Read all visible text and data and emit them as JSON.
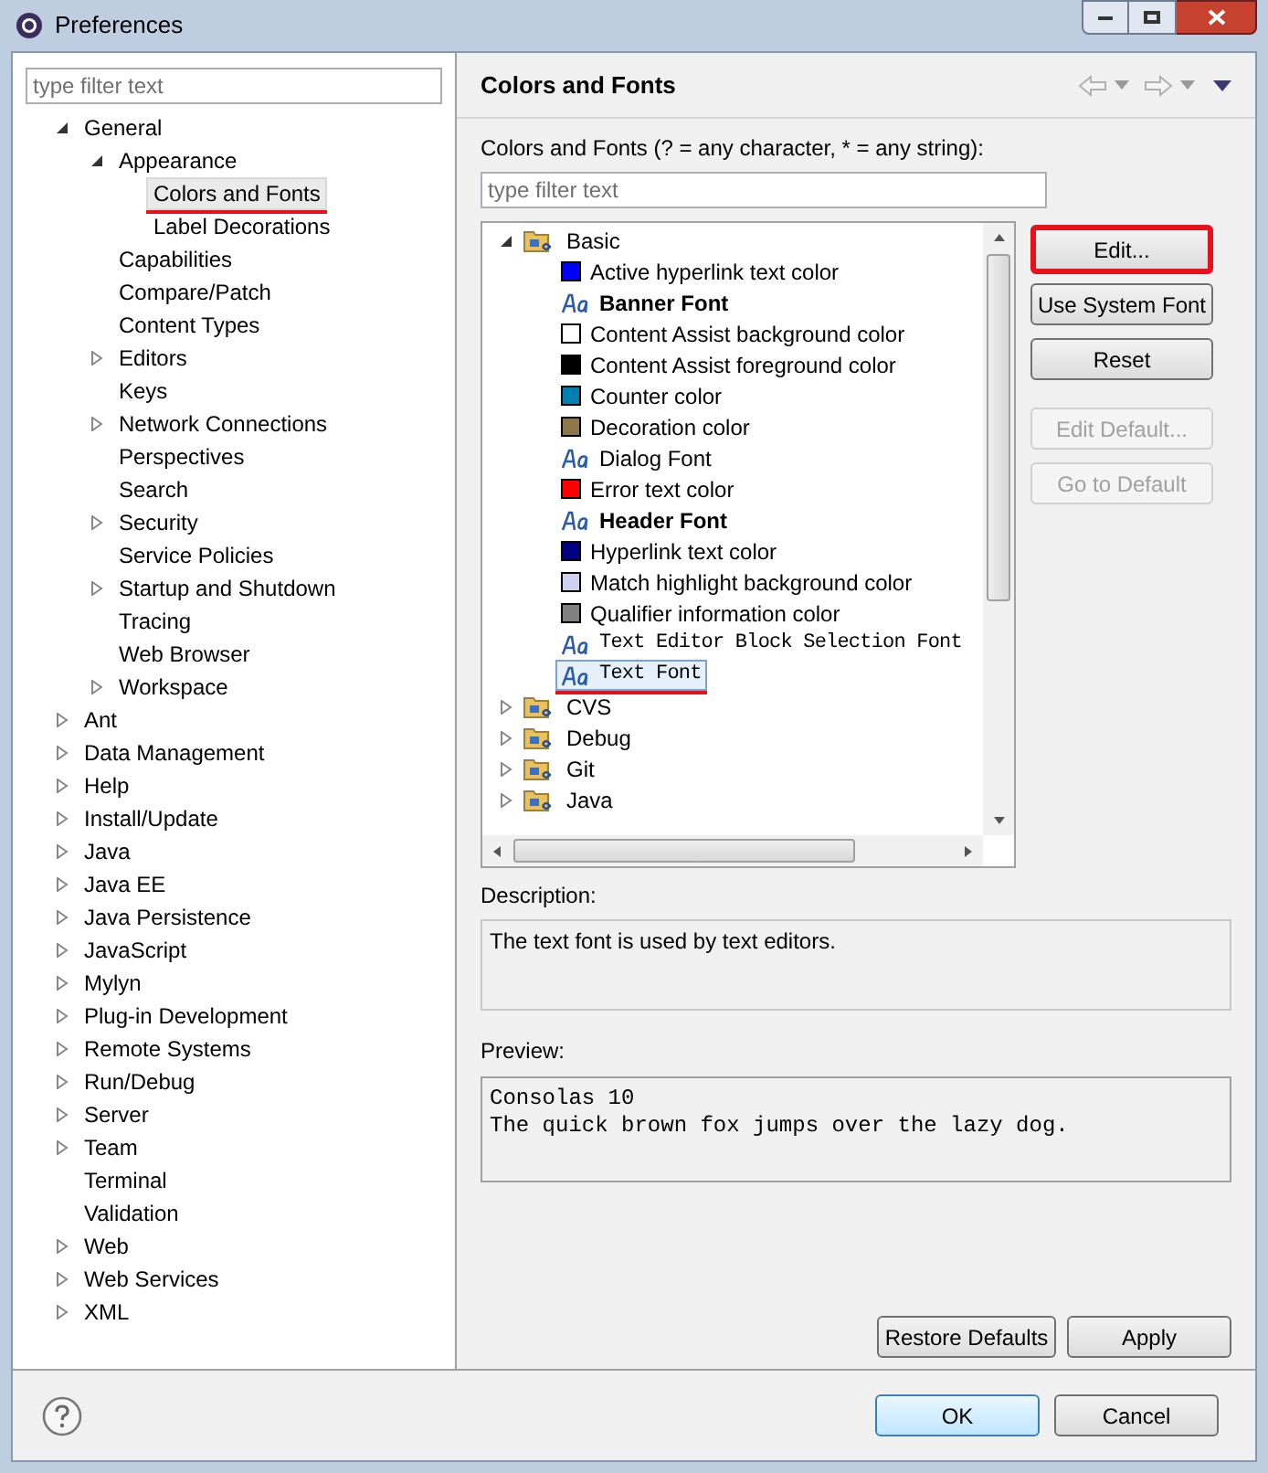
{
  "window": {
    "title": "Preferences"
  },
  "sidebar": {
    "filter": {
      "placeholder": "type filter text"
    },
    "items": [
      {
        "label": "General",
        "expanded": true,
        "selected": false,
        "children": [
          {
            "label": "Appearance",
            "expanded": true,
            "selected": false,
            "children": [
              {
                "label": "Colors and Fonts",
                "selected": true
              },
              {
                "label": "Label Decorations",
                "selected": false
              }
            ]
          },
          {
            "label": "Capabilities",
            "selected": false
          },
          {
            "label": "Compare/Patch",
            "selected": false
          },
          {
            "label": "Content Types",
            "selected": false
          },
          {
            "label": "Editors",
            "expanded": false,
            "selected": false
          },
          {
            "label": "Keys",
            "selected": false
          },
          {
            "label": "Network Connections",
            "expanded": false,
            "selected": false
          },
          {
            "label": "Perspectives",
            "selected": false
          },
          {
            "label": "Search",
            "selected": false
          },
          {
            "label": "Security",
            "expanded": false,
            "selected": false
          },
          {
            "label": "Service Policies",
            "selected": false
          },
          {
            "label": "Startup and Shutdown",
            "expanded": false,
            "selected": false
          },
          {
            "label": "Tracing",
            "selected": false
          },
          {
            "label": "Web Browser",
            "selected": false
          },
          {
            "label": "Workspace",
            "expanded": false,
            "selected": false
          }
        ]
      },
      {
        "label": "Ant",
        "expanded": false,
        "selected": false
      },
      {
        "label": "Data Management",
        "expanded": false,
        "selected": false
      },
      {
        "label": "Help",
        "expanded": false,
        "selected": false
      },
      {
        "label": "Install/Update",
        "expanded": false,
        "selected": false
      },
      {
        "label": "Java",
        "expanded": false,
        "selected": false
      },
      {
        "label": "Java EE",
        "expanded": false,
        "selected": false
      },
      {
        "label": "Java Persistence",
        "expanded": false,
        "selected": false
      },
      {
        "label": "JavaScript",
        "expanded": false,
        "selected": false
      },
      {
        "label": "Mylyn",
        "expanded": false,
        "selected": false
      },
      {
        "label": "Plug-in Development",
        "expanded": false,
        "selected": false
      },
      {
        "label": "Remote Systems",
        "expanded": false,
        "selected": false
      },
      {
        "label": "Run/Debug",
        "expanded": false,
        "selected": false
      },
      {
        "label": "Server",
        "expanded": false,
        "selected": false
      },
      {
        "label": "Team",
        "expanded": false,
        "selected": false
      },
      {
        "label": "Terminal",
        "selected": false
      },
      {
        "label": "Validation",
        "selected": false
      },
      {
        "label": "Web",
        "expanded": false,
        "selected": false
      },
      {
        "label": "Web Services",
        "expanded": false,
        "selected": false
      },
      {
        "label": "XML",
        "expanded": false,
        "selected": false
      }
    ]
  },
  "page": {
    "title": "Colors and Fonts",
    "filter_label": "Colors and Fonts (? = any character, * = any string):",
    "filter": {
      "placeholder": "type filter text"
    },
    "categories": [
      {
        "label": "Basic",
        "expanded": true,
        "children": [
          {
            "kind": "color",
            "label": "Active hyperlink text color",
            "color": "#0000ff",
            "selected": false
          },
          {
            "kind": "boldfont",
            "label": "Banner Font",
            "selected": false
          },
          {
            "kind": "color",
            "label": "Content Assist background color",
            "color": "#ffffff",
            "selected": false
          },
          {
            "kind": "color",
            "label": "Content Assist foreground color",
            "color": "#000000",
            "selected": false
          },
          {
            "kind": "color",
            "label": "Counter color",
            "color": "#0080b0",
            "selected": false
          },
          {
            "kind": "color",
            "label": "Decoration color",
            "color": "#8c7848",
            "selected": false
          },
          {
            "kind": "font",
            "label": "Dialog Font",
            "selected": false
          },
          {
            "kind": "color",
            "label": "Error text color",
            "color": "#ff0000",
            "selected": false
          },
          {
            "kind": "boldfont",
            "label": "Header Font",
            "selected": false
          },
          {
            "kind": "color",
            "label": "Hyperlink text color",
            "color": "#000080",
            "selected": false
          },
          {
            "kind": "color",
            "label": "Match highlight background color",
            "color": "#d0d0f0",
            "selected": false
          },
          {
            "kind": "color",
            "label": "Qualifier information color",
            "color": "#808080",
            "selected": false
          },
          {
            "kind": "monofont",
            "label": "Text Editor Block Selection Font",
            "selected": false
          },
          {
            "kind": "monofont",
            "label": "Text Font",
            "selected": true
          }
        ]
      },
      {
        "label": "CVS",
        "expanded": false
      },
      {
        "label": "Debug",
        "expanded": false
      },
      {
        "label": "Git",
        "expanded": false
      },
      {
        "label": "Java",
        "expanded": false
      }
    ],
    "buttons": [
      {
        "label": "Edit...",
        "disabled": false,
        "highlighted": true
      },
      {
        "label": "Use System Font",
        "disabled": false,
        "highlighted": false
      },
      {
        "label": "Reset",
        "disabled": false,
        "highlighted": false
      },
      {
        "label": "Edit Default...",
        "disabled": true,
        "highlighted": false
      },
      {
        "label": "Go to Default",
        "disabled": true,
        "highlighted": false
      }
    ],
    "description_label": "Description:",
    "description": "The text font is used by text editors.",
    "preview_label": "Preview:",
    "preview": [
      "Consolas 10",
      "The quick brown fox jumps over the lazy dog."
    ],
    "page_buttons": [
      "Restore Defaults",
      "Apply"
    ]
  },
  "footer": {
    "buttons": [
      {
        "label": "OK",
        "default": true
      },
      {
        "label": "Cancel",
        "default": false
      }
    ]
  }
}
